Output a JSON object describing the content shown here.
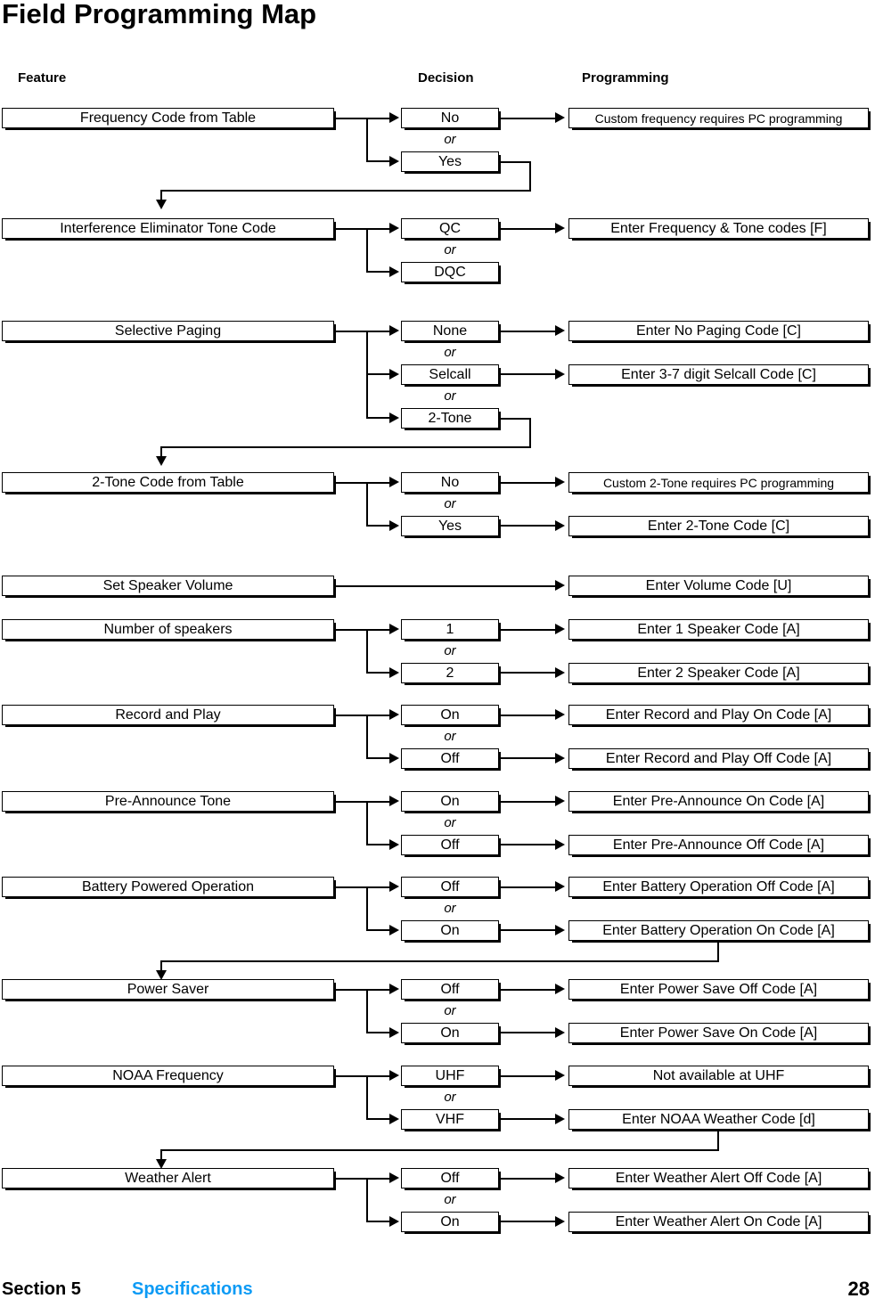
{
  "title": "Field Programming Map",
  "columns": {
    "feature": "Feature",
    "decision": "Decision",
    "programming": "Programming"
  },
  "rows": [
    {
      "feature": "Frequency Code from Table",
      "decision": "No",
      "programming": "Custom frequency requires PC programming"
    },
    {
      "feature": "",
      "decision": "Yes",
      "programming": ""
    },
    {
      "feature": "Interference Eliminator Tone Code",
      "decision": "QC",
      "programming": "Enter Frequency & Tone codes [F]"
    },
    {
      "feature": "",
      "decision": "DQC",
      "programming": ""
    },
    {
      "feature": "Selective Paging",
      "decision": "None",
      "programming": "Enter No Paging Code [C]"
    },
    {
      "feature": "",
      "decision": "Selcall",
      "programming": "Enter 3-7 digit Selcall Code [C]"
    },
    {
      "feature": "",
      "decision": "2-Tone",
      "programming": ""
    },
    {
      "feature": "2-Tone Code from Table",
      "decision": "No",
      "programming": "Custom 2-Tone requires PC programming"
    },
    {
      "feature": "",
      "decision": "Yes",
      "programming": "Enter 2-Tone Code [C]"
    },
    {
      "feature": "Set Speaker Volume",
      "decision": "",
      "programming": "Enter Volume Code [U]"
    },
    {
      "feature": "Number of speakers",
      "decision": "1",
      "programming": "Enter 1 Speaker Code [A]"
    },
    {
      "feature": "",
      "decision": "2",
      "programming": "Enter 2 Speaker Code [A]"
    },
    {
      "feature": "Record and Play",
      "decision": "On",
      "programming": "Enter Record and Play On Code [A]"
    },
    {
      "feature": "",
      "decision": "Off",
      "programming": "Enter Record and Play Off Code [A]"
    },
    {
      "feature": "Pre-Announce Tone",
      "decision": "On",
      "programming": "Enter Pre-Announce On Code [A]"
    },
    {
      "feature": "",
      "decision": "Off",
      "programming": "Enter Pre-Announce Off Code [A]"
    },
    {
      "feature": "Battery Powered Operation",
      "decision": "Off",
      "programming": "Enter Battery Operation Off Code [A]"
    },
    {
      "feature": "",
      "decision": "On",
      "programming": "Enter Battery Operation On Code [A]"
    },
    {
      "feature": "Power Saver",
      "decision": "Off",
      "programming": "Enter Power Save Off Code [A]"
    },
    {
      "feature": "",
      "decision": "On",
      "programming": "Enter Power Save On Code [A]"
    },
    {
      "feature": "NOAA Frequency",
      "decision": "UHF",
      "programming": "Not available at UHF"
    },
    {
      "feature": "",
      "decision": "VHF",
      "programming": "Enter NOAA Weather Code [d]"
    },
    {
      "feature": "Weather Alert",
      "decision": "Off",
      "programming": "Enter Weather Alert Off Code [A]"
    },
    {
      "feature": "",
      "decision": "On",
      "programming": "Enter Weather Alert On Code [A]"
    }
  ],
  "or_label": "or",
  "footer": {
    "section": "Section 5",
    "chapter": "Specifications",
    "page": "28",
    "chapter_color": "#0d9bf5"
  }
}
